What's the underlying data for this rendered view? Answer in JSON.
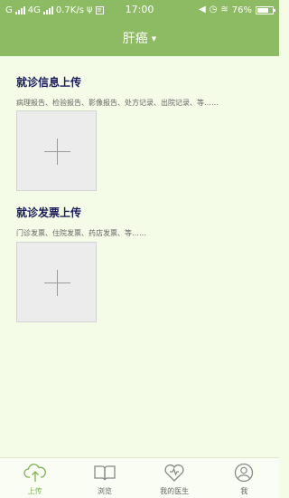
{
  "status_bar": {
    "carrier_1": "G",
    "carrier_2": "4G",
    "speed": "0.7K/s",
    "time": "17:00",
    "battery": "76%"
  },
  "header": {
    "title": "肝癌",
    "caret": "▼"
  },
  "sections": [
    {
      "title": "就诊信息上传",
      "description": "病理报告、检验报告、影像报告、处方记录、出院记录、等……"
    },
    {
      "title": "就诊发票上传",
      "description": "门诊发票、住院发票、药店发票、等……"
    }
  ],
  "tabs": [
    {
      "label": "上传",
      "icon": "cloud-upload-icon",
      "active": true
    },
    {
      "label": "浏览",
      "icon": "book-icon",
      "active": false
    },
    {
      "label": "我的医生",
      "icon": "heart-stethoscope-icon",
      "active": false
    },
    {
      "label": "我",
      "icon": "user-icon",
      "active": false
    }
  ],
  "colors": {
    "accent": "#8dbb63",
    "tab_active": "#7fb24e",
    "background": "#f4fbe6"
  }
}
